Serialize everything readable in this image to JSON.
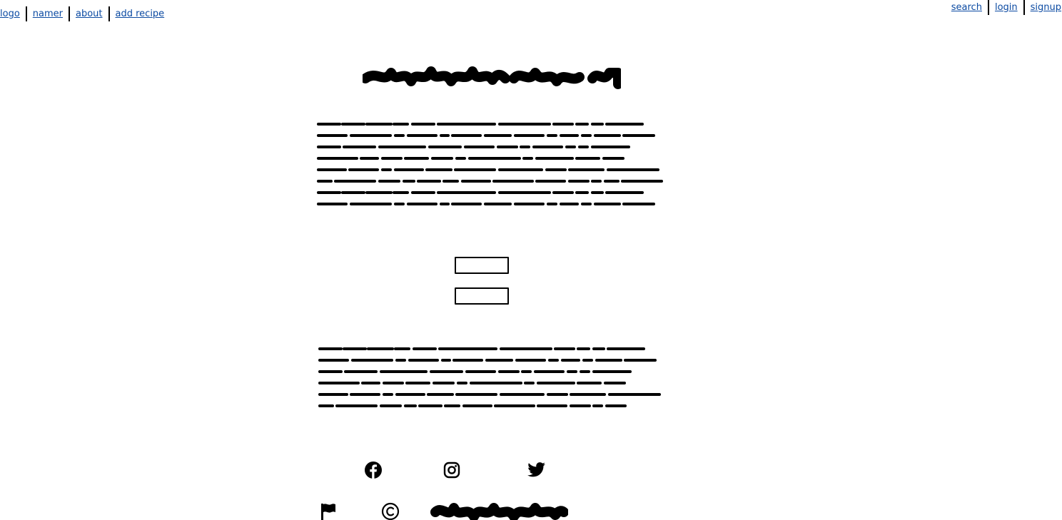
{
  "nav": {
    "left": [
      {
        "label": "logo"
      },
      {
        "label": "namer"
      },
      {
        "label": "about"
      },
      {
        "label": "add recipe"
      }
    ],
    "right": [
      {
        "label": "search"
      },
      {
        "label": "login"
      },
      {
        "label": "signup"
      }
    ]
  },
  "main": {
    "title_placeholder": "scribbled-heading",
    "paragraph1_lines": 8,
    "paragraph2_lines": 6,
    "input1": {
      "value": "",
      "placeholder": ""
    },
    "input2": {
      "value": "",
      "placeholder": ""
    }
  },
  "footer": {
    "social_icons": [
      "facebook-icon",
      "instagram-icon",
      "twitter-icon"
    ],
    "bottom_icons": [
      "flag-icon",
      "copyright-icon"
    ]
  },
  "colors": {
    "link": "#0b4aa2",
    "ink": "#000000",
    "background": "#ffffff"
  }
}
